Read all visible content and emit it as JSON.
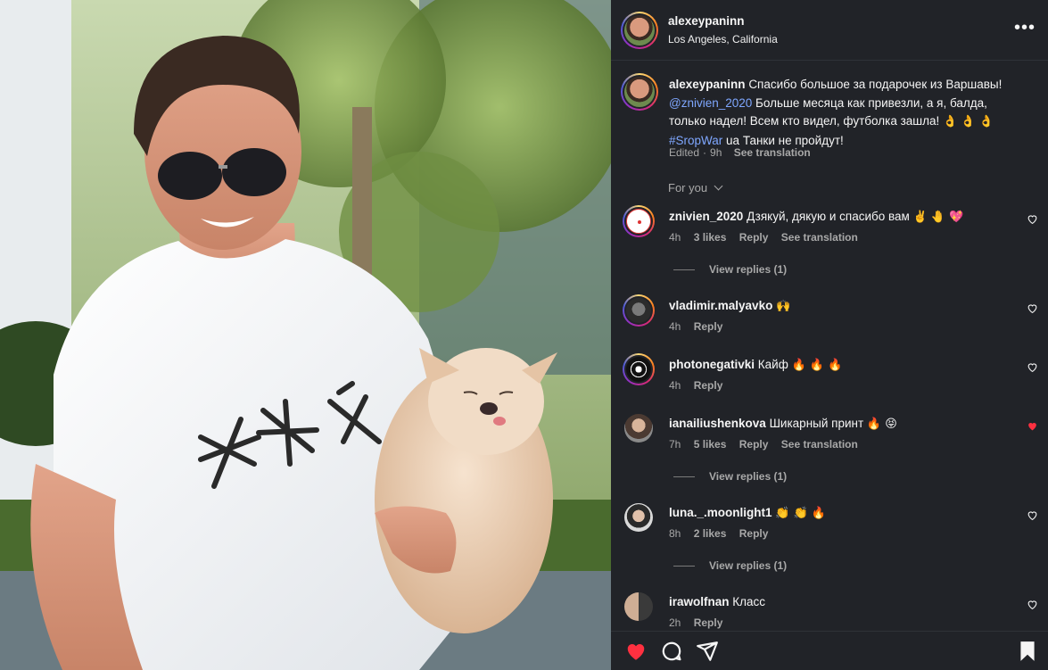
{
  "post": {
    "username": "alexeypaninn",
    "location": "Los Angeles, California",
    "more_label": "•••",
    "caption": {
      "username": "alexeypaninn",
      "text_part1": "Спасибо большое за подарочек из Варшавы!",
      "mention": "@znivien_2020",
      "text_part2": "Больше месяца как привезли, а я, балда, только надел! Всем кто видел, футболка зашла!",
      "emoji1": "👌 👌 👌",
      "hashtag": "#SropWar",
      "text_part3": "ua Танки не пройдут!",
      "edited": "Edited",
      "time": "9h",
      "see_translation": "See translation"
    }
  },
  "for_you_label": "For you",
  "comments": [
    {
      "username": "znivien_2020",
      "text": "Дзякуй, дякую и спасибо вам",
      "emoji": "✌️ 🤚 💖",
      "time": "4h",
      "likes": "3 likes",
      "reply": "Reply",
      "see_translation": "See translation",
      "view_replies": "View replies (1)",
      "liked": false
    },
    {
      "username": "vladimir.malyavko",
      "text": "",
      "emoji": "🙌",
      "time": "4h",
      "reply": "Reply",
      "liked": false
    },
    {
      "username": "photonegativki",
      "text": "Кайф",
      "emoji": "🔥 🔥 🔥",
      "time": "4h",
      "reply": "Reply",
      "liked": false
    },
    {
      "username": "ianailiushenkova",
      "text": "Шикарный принт",
      "emoji": "🔥 😝",
      "time": "7h",
      "likes": "5 likes",
      "reply": "Reply",
      "see_translation": "See translation",
      "view_replies": "View replies (1)",
      "liked": true
    },
    {
      "username": "luna._.moonlight1",
      "text": "",
      "emoji": "👏 👏 🔥",
      "time": "8h",
      "likes": "2 likes",
      "reply": "Reply",
      "view_replies": "View replies (1)",
      "liked": false
    },
    {
      "username": "irawolfnan",
      "text": "Класс",
      "emoji": "",
      "time": "2h",
      "reply": "Reply",
      "liked": false
    }
  ],
  "actions": {
    "like_icon": "heart-filled-icon",
    "comment_icon": "comment-icon",
    "share_icon": "share-icon",
    "save_icon": "bookmark-icon"
  },
  "colors": {
    "panel_bg": "#212328",
    "like_red": "#ff3040",
    "link_blue": "#7fa7ff",
    "muted": "#a8a8a8"
  }
}
